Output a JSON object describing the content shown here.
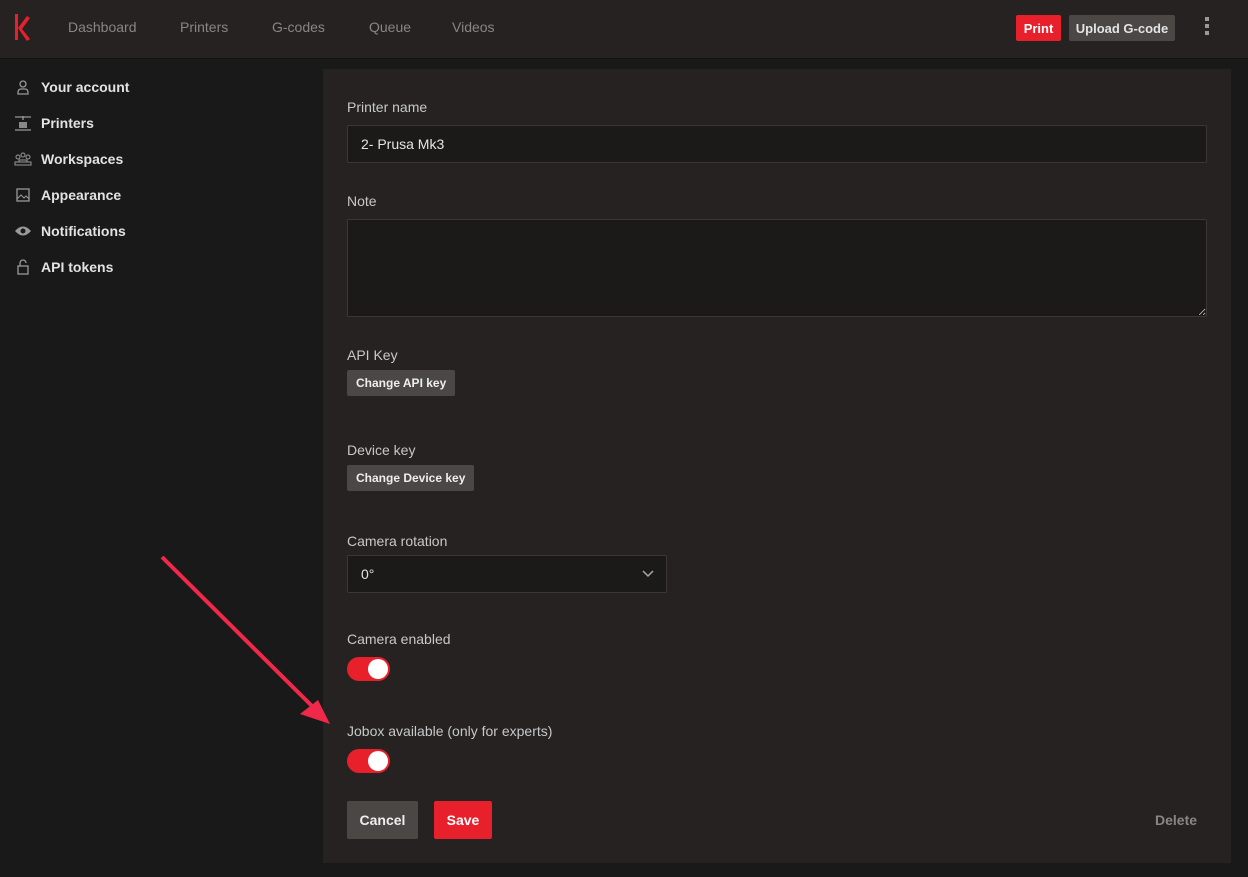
{
  "header": {
    "nav": [
      "Dashboard",
      "Printers",
      "G-codes",
      "Queue",
      "Videos"
    ],
    "print_label": "Print",
    "upload_label": "Upload G-code"
  },
  "sidebar": {
    "items": [
      {
        "label": "Your account",
        "icon": "user-icon"
      },
      {
        "label": "Printers",
        "icon": "printer-icon"
      },
      {
        "label": "Workspaces",
        "icon": "team-icon"
      },
      {
        "label": "Appearance",
        "icon": "image-icon"
      },
      {
        "label": "Notifications",
        "icon": "eye-icon"
      },
      {
        "label": "API tokens",
        "icon": "unlock-icon"
      }
    ]
  },
  "form": {
    "printer_name_label": "Printer name",
    "printer_name_value": "2- Prusa Mk3",
    "note_label": "Note",
    "note_value": "",
    "api_key_label": "API Key",
    "api_key_button": "Change API key",
    "device_key_label": "Device key",
    "device_key_button": "Change Device key",
    "camera_rotation_label": "Camera rotation",
    "camera_rotation_value": "0°",
    "camera_enabled_label": "Camera enabled",
    "camera_enabled": true,
    "jobox_label": "Jobox available (only for experts)",
    "jobox_enabled": true,
    "cancel_label": "Cancel",
    "save_label": "Save",
    "delete_label": "Delete"
  },
  "colors": {
    "accent": "#e8202b",
    "annotation_arrow": "#f0284a"
  }
}
